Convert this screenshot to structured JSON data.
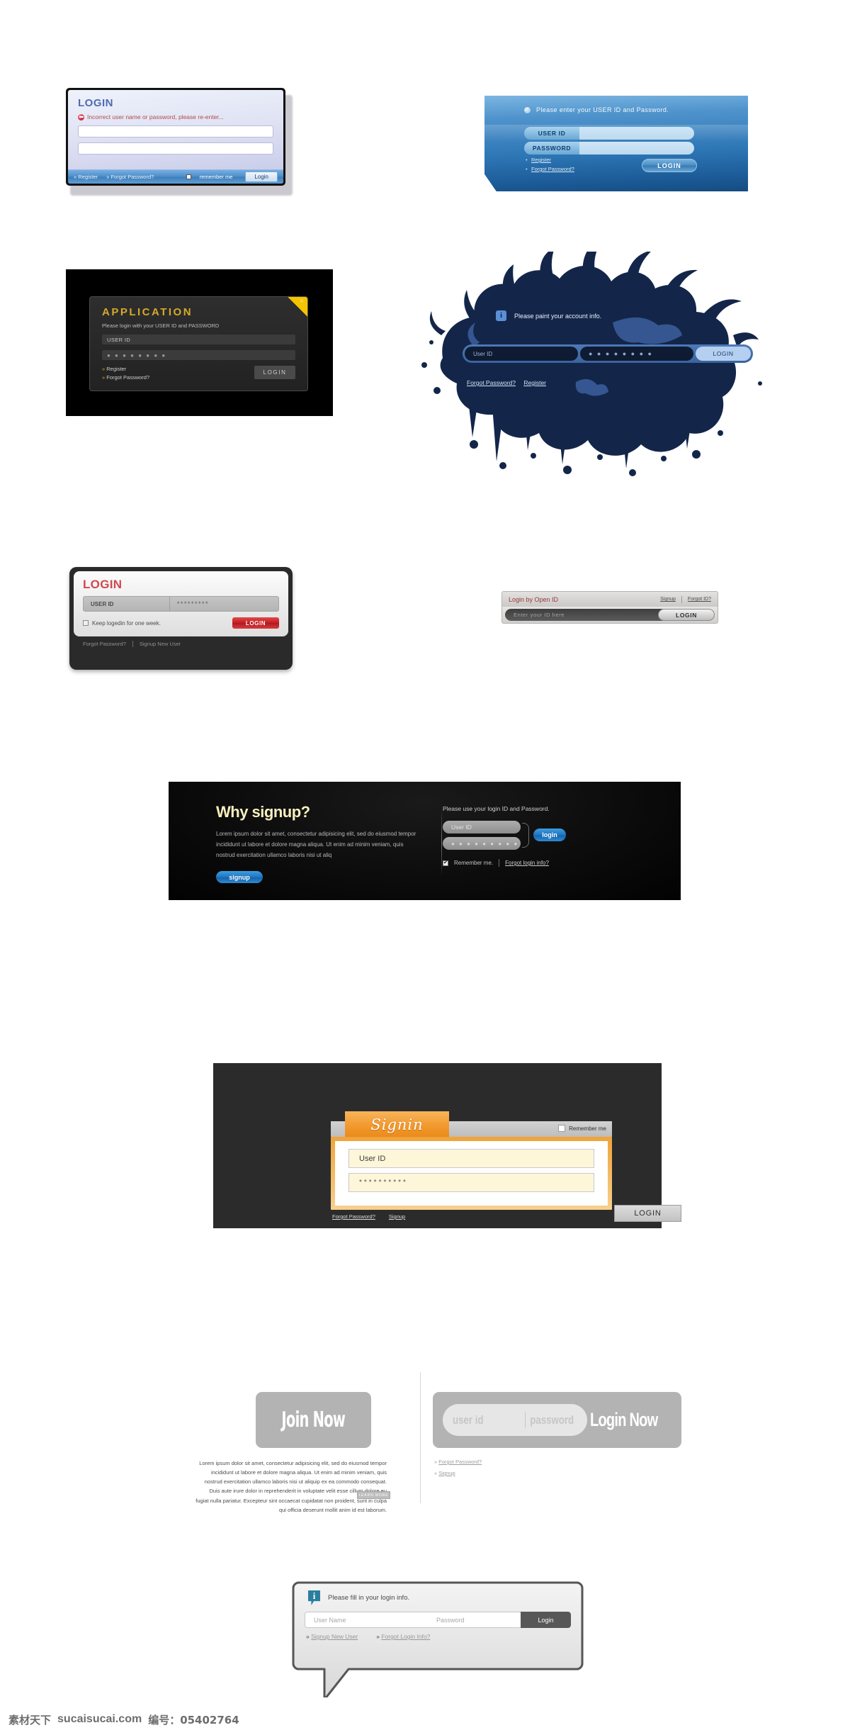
{
  "forms": {
    "lavender": {
      "title": "LOGIN",
      "error": "Incorrect user name or password, please re-enter...",
      "register": "» Register",
      "forgot": "» Forgot Password?",
      "remember": "remember me",
      "login": "Login"
    },
    "blue": {
      "message": "Please enter your USER ID and Password.",
      "user_label": "USER ID",
      "pass_label": "PASSWORD",
      "register": "Register",
      "forgot": "Forgot Password?",
      "login": "LOGIN"
    },
    "application": {
      "title": "APPLICATION",
      "subtitle": "Please login with your USER ID and PASSWORD",
      "user_value": "USER ID",
      "pass_value": "● ● ● ● ● ● ● ●",
      "register": "Register",
      "forgot": "Forgot Password?",
      "login": "LOGIN",
      "close": "×"
    },
    "ink": {
      "message": "Please paint your account info.",
      "info_icon": "i",
      "user_placeholder": "User ID",
      "pass_value": "● ● ● ● ● ● ● ●",
      "login": "LOGIN",
      "forgot": "Forgot Password?",
      "register": "Register"
    },
    "grey": {
      "title": "LOGIN",
      "user_value": "USER ID",
      "pass_value": "*********",
      "keep": "Keep logedin for one week.",
      "login": "LOGIN",
      "forgot": "Forgot Password?",
      "signup": "Signup New User"
    },
    "openid": {
      "title": "Login by Open ID",
      "signup": "Signup",
      "forgot": "Forgot ID?",
      "placeholder": "Enter your ID here",
      "login": "LOGIN"
    },
    "why_signup": {
      "heading": "Why signup?",
      "paragraph": "Lorem ipsum dolor sit amet, consectetur adipisicing elit, sed do eiusmod tempor incididunt ut labore et dolore magna aliqua. Ut enim ad minim veniam, quis nostrud exercitation ullamco laboris nisi ut aliq",
      "signup_button": "signup",
      "lead": "Please use your login ID and Password.",
      "user_placeholder": "User ID",
      "pass_value": "● ● ● ● ● ● ● ● ●",
      "login": "login",
      "remember": "Remember me.",
      "forgot": "Forgot login info?"
    },
    "signin": {
      "tab_title": "Signin",
      "remember": "Remember me",
      "user_value": "User ID",
      "pass_value": "**********",
      "forgot": "Forgot Password?",
      "signup": "Signup",
      "login": "LOGIN"
    },
    "join": {
      "join_button": "Join Now",
      "paragraph": "Lorem ipsum dolor sit amet, consectetur adipisicing elit, sed do eiusmod tempor incididunt ut labore et dolore magna aliqua. Ut enim ad minim veniam, quis nostrud exercitation ullamco laboris nisi ut aliquip ex ea commodo consequat. Duis aute irure dolor in reprehenderit in voluptate velit esse cillum dolore eu fugiat nulla pariatur. Excepteur sint occaecat cupidatat non proident, sunt in culpa qui officia deserunt mollit anim id est laborum.",
      "learn_more": "LEARN MORE",
      "user_placeholder": "user id",
      "pass_placeholder": "password",
      "login_button": "Login Now",
      "forgot": "Forgot Password?",
      "signup": "Signup"
    },
    "bubble": {
      "info_icon": "i",
      "message": "Please fill in your login info.",
      "user_placeholder": "User Name",
      "pass_placeholder": "Password",
      "login": "Login",
      "signup": "Signup New User",
      "forgot": "Forgot Login Info?",
      "arrow": "»"
    }
  },
  "footer": {
    "site_cn": "素材天下",
    "domain": "sucaisucai.com",
    "number": "编号：05402764"
  },
  "colors": {
    "lavender_title": "#4f6bb0",
    "error_red": "#b24a4a",
    "blue_accent": "#2e77b6",
    "gold": "#d6a92b",
    "ink_navy": "#13264a",
    "red_button": "#c41f22",
    "orange": "#f2992e",
    "info_teal": "#2b7f9e"
  }
}
